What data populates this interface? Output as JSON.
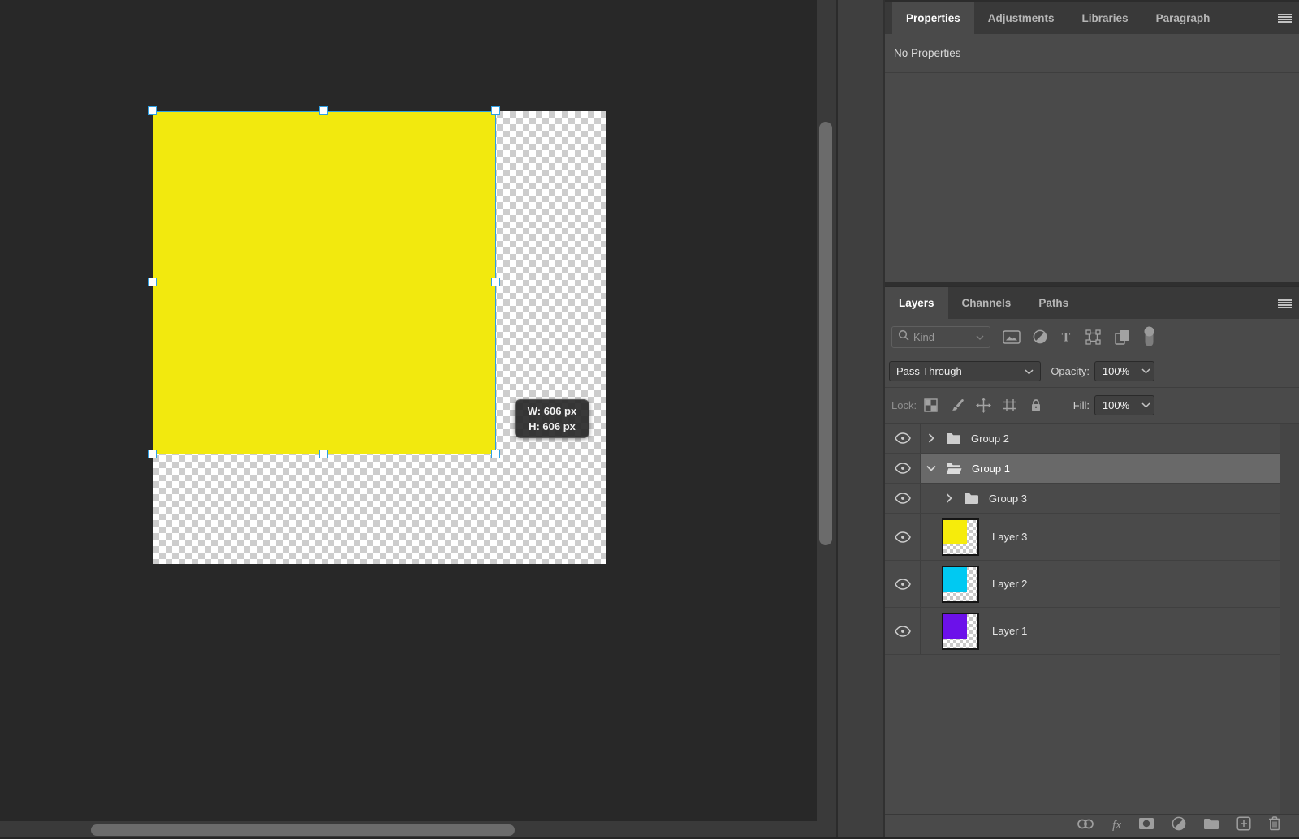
{
  "properties_panel": {
    "tabs": [
      {
        "label": "Properties",
        "active": true
      },
      {
        "label": "Adjustments",
        "active": false
      },
      {
        "label": "Libraries",
        "active": false
      },
      {
        "label": "Paragraph",
        "active": false
      }
    ],
    "empty_message": "No Properties"
  },
  "layers_panel": {
    "tabs": [
      {
        "label": "Layers",
        "active": true
      },
      {
        "label": "Channels",
        "active": false
      },
      {
        "label": "Paths",
        "active": false
      }
    ],
    "filter_row": {
      "search_placeholder": "Kind",
      "filter_icons": [
        "pixel-layer-filter-icon",
        "adjustment-layer-filter-icon",
        "type-layer-filter-icon",
        "shape-layer-filter-icon",
        "smart-object-filter-icon",
        "layer-filtering-toggle"
      ]
    },
    "blend_mode_value": "Pass Through",
    "opacity_label": "Opacity:",
    "opacity_value": "100%",
    "lock_label": "Lock:",
    "lock_icons": [
      "lock-transparent-pixels-icon",
      "lock-image-pixels-icon",
      "lock-position-icon",
      "lock-artboard-nesting-icon",
      "lock-all-icon"
    ],
    "fill_label": "Fill:",
    "fill_value": "100%",
    "layers": [
      {
        "name": "Group 2",
        "type": "group",
        "state": "collapsed",
        "selected": false
      },
      {
        "name": "Group 1",
        "type": "group",
        "state": "expanded",
        "selected": true
      },
      {
        "name": "Group 3",
        "type": "group",
        "state": "collapsed",
        "selected": false,
        "nested": true
      },
      {
        "name": "Layer 3",
        "type": "layer",
        "thumbnail_color": "#f6ec0b"
      },
      {
        "name": "Layer 2",
        "type": "layer",
        "thumbnail_color": "#00c9f2"
      },
      {
        "name": "Layer 1",
        "type": "layer",
        "thumbnail_color": "#6c11ea"
      }
    ],
    "footer_icons": [
      "link-layers-icon",
      "layer-style-fx-icon",
      "add-layer-mask-icon",
      "new-adjustment-layer-icon",
      "new-group-icon",
      "new-layer-icon",
      "delete-layer-icon"
    ]
  },
  "canvas": {
    "artwork_color": "#f2e90e",
    "selection_color": "#2f9fe3",
    "size_tooltip": {
      "width_text": "W: 606 px",
      "height_text": "H: 606 px"
    }
  }
}
